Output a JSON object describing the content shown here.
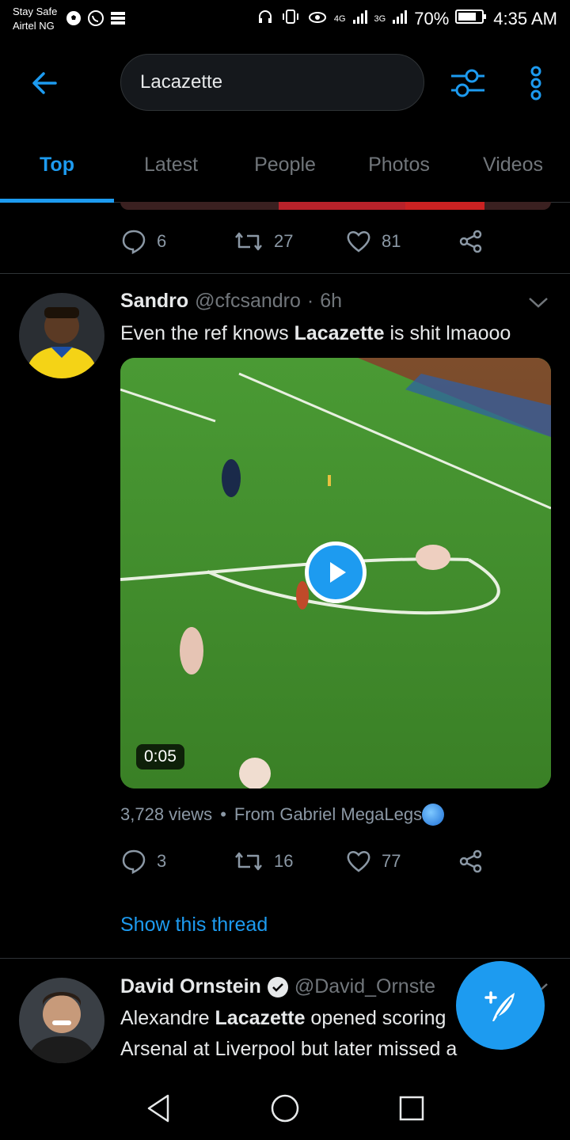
{
  "status_bar": {
    "carrier_line1": "Stay Safe",
    "carrier_line2": "Airtel NG",
    "net1": "4G",
    "net2": "3G",
    "battery": "70%",
    "time": "4:35 AM"
  },
  "header": {
    "search_value": "Lacazette",
    "back_icon": "arrow-left-icon",
    "filter_icon": "sliders-icon",
    "more_icon": "more-vertical-icon"
  },
  "tabs": [
    {
      "label": "Top",
      "active": true
    },
    {
      "label": "Latest",
      "active": false
    },
    {
      "label": "People",
      "active": false
    },
    {
      "label": "Photos",
      "active": false
    },
    {
      "label": "Videos",
      "active": false
    }
  ],
  "prev_tweet": {
    "replies": "6",
    "retweets": "27",
    "likes": "81"
  },
  "tweet1": {
    "name": "Sandro",
    "handle": "@cfcsandro",
    "sep": "·",
    "time": "6h",
    "text_before": "Even the ref knows ",
    "text_bold": "Lacazette",
    "text_after": " is shit lmaooo",
    "video_duration": "0:05",
    "views": "3,728 views",
    "dot": "•",
    "source": "From Gabriel MegaLegs",
    "replies": "3",
    "retweets": "16",
    "likes": "77",
    "thread_link": "Show this thread"
  },
  "tweet2": {
    "name": "David Ornstein",
    "handle": "@David_Ornste",
    "line1_before": "Alexandre ",
    "line1_bold": "Lacazette",
    "line1_after": " opened scoring",
    "line2": "Arsenal at Liverpool but later missed a"
  },
  "colors": {
    "accent": "#1d9bf0",
    "background": "#000000",
    "muted": "#71767b"
  }
}
